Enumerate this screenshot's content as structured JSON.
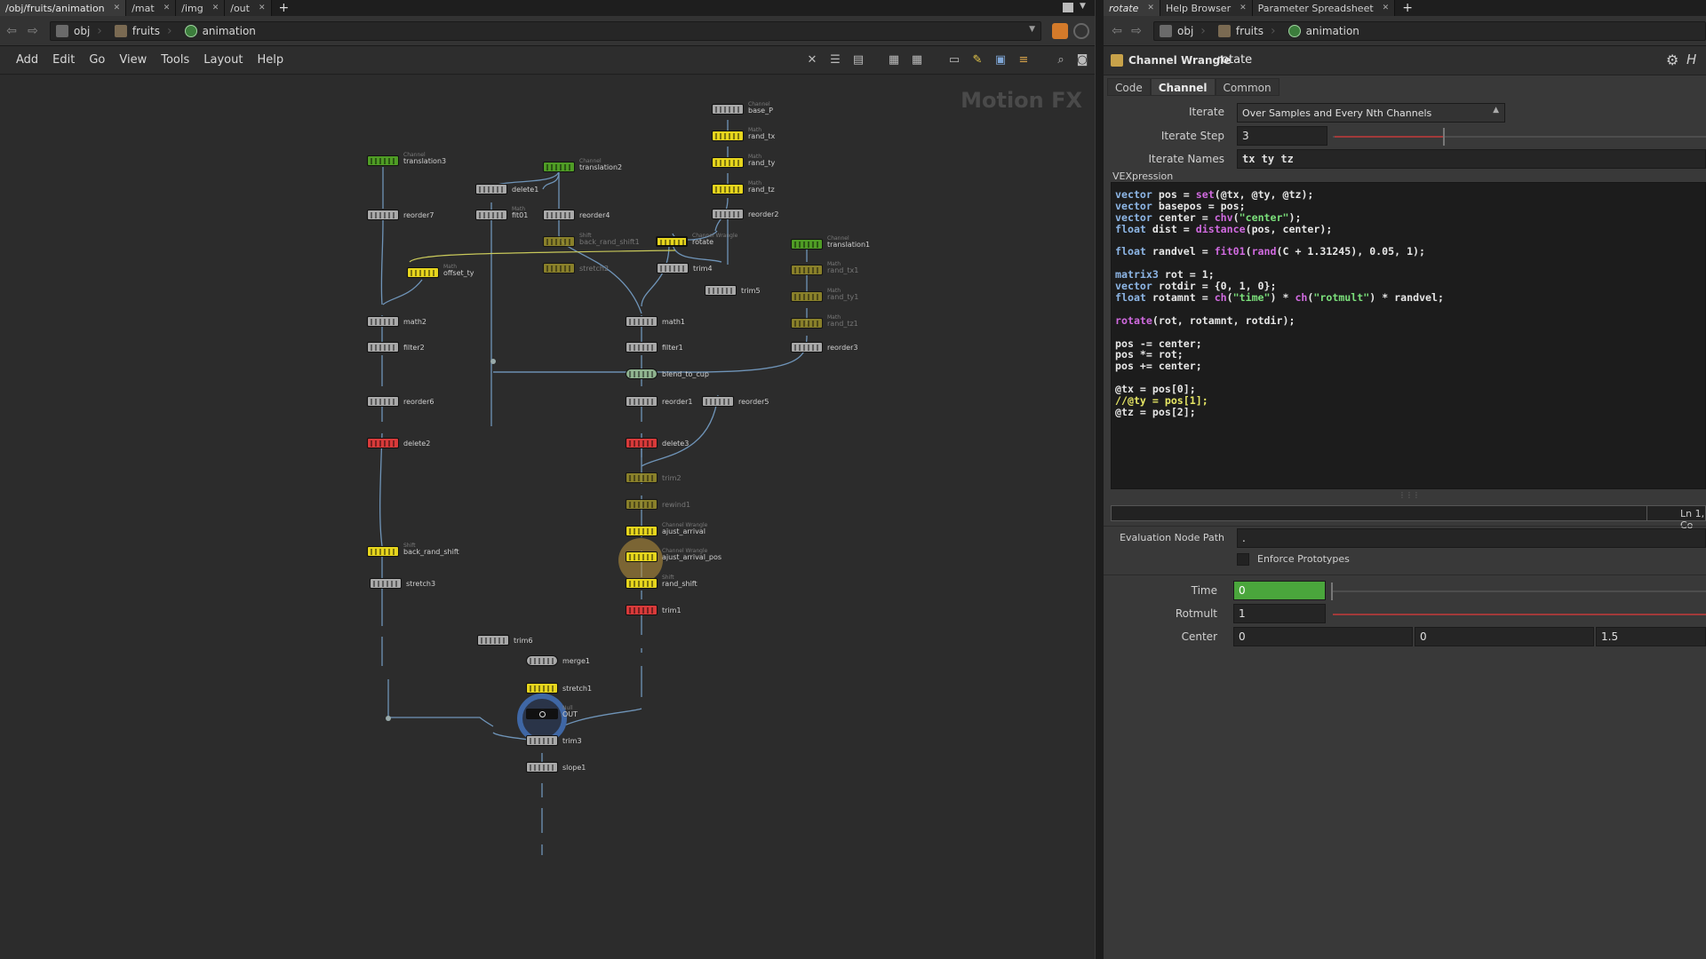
{
  "left_tabs": [
    {
      "label": "/obj/fruits/animation"
    },
    {
      "label": "/mat"
    },
    {
      "label": "/img"
    },
    {
      "label": "/out"
    }
  ],
  "right_tabs": [
    {
      "label": "rotate"
    },
    {
      "label": "Help Browser"
    },
    {
      "label": "Parameter Spreadsheet"
    }
  ],
  "path_left": {
    "obj": "obj",
    "fruits": "fruits",
    "animation": "animation"
  },
  "path_right": {
    "obj": "obj",
    "fruits": "fruits",
    "animation": "animation"
  },
  "menu": [
    "Add",
    "Edit",
    "Go",
    "View",
    "Tools",
    "Layout",
    "Help"
  ],
  "network": {
    "watermark": "Motion FX",
    "nodes": [
      {
        "id": "base_P",
        "label": "base_P",
        "type": "Channel"
      },
      {
        "id": "rand_tx",
        "label": "rand_tx",
        "type": "Math"
      },
      {
        "id": "rand_ty",
        "label": "rand_ty",
        "type": "Math"
      },
      {
        "id": "rand_tz",
        "label": "rand_tz",
        "type": "Math"
      },
      {
        "id": "reorder2",
        "label": "reorder2",
        "type": ""
      },
      {
        "id": "translation3",
        "label": "translation3",
        "type": "Channel"
      },
      {
        "id": "translation2",
        "label": "translation2",
        "type": "Channel"
      },
      {
        "id": "delete1",
        "label": "delete1",
        "type": ""
      },
      {
        "id": "fit01",
        "label": "fit01",
        "type": "Math"
      },
      {
        "id": "reorder7",
        "label": "reorder7",
        "type": ""
      },
      {
        "id": "reorder4",
        "label": "reorder4",
        "type": ""
      },
      {
        "id": "back_rand_shift1",
        "label": "back_rand_shift1",
        "type": "Shift"
      },
      {
        "id": "rotate",
        "label": "rotate",
        "type": "Channel Wrangle"
      },
      {
        "id": "translation1",
        "label": "translation1",
        "type": "Channel"
      },
      {
        "id": "offset_ty",
        "label": "offset_ty",
        "type": "Math"
      },
      {
        "id": "stretch2",
        "label": "stretch2",
        "type": ""
      },
      {
        "id": "trim4",
        "label": "trim4",
        "type": ""
      },
      {
        "id": "rand_tx1",
        "label": "rand_tx1",
        "type": "Math"
      },
      {
        "id": "trim5",
        "label": "trim5",
        "type": ""
      },
      {
        "id": "rand_ty1",
        "label": "rand_ty1",
        "type": "Math"
      },
      {
        "id": "math2",
        "label": "math2",
        "type": ""
      },
      {
        "id": "math1",
        "label": "math1",
        "type": ""
      },
      {
        "id": "rand_tz1",
        "label": "rand_tz1",
        "type": "Math"
      },
      {
        "id": "filter2",
        "label": "filter2",
        "type": ""
      },
      {
        "id": "filter1",
        "label": "filter1",
        "type": ""
      },
      {
        "id": "reorder3",
        "label": "reorder3",
        "type": ""
      },
      {
        "id": "blend_to_cup",
        "label": "blend_to_cup",
        "type": ""
      },
      {
        "id": "reorder6",
        "label": "reorder6",
        "type": ""
      },
      {
        "id": "reorder1",
        "label": "reorder1",
        "type": ""
      },
      {
        "id": "reorder5",
        "label": "reorder5",
        "type": ""
      },
      {
        "id": "delete2",
        "label": "delete2",
        "type": ""
      },
      {
        "id": "delete3",
        "label": "delete3",
        "type": ""
      },
      {
        "id": "trim2",
        "label": "trim2",
        "type": ""
      },
      {
        "id": "rewind1",
        "label": "rewind1",
        "type": ""
      },
      {
        "id": "ajust_arrival",
        "label": "ajust_arrival",
        "type": "Channel Wrangle"
      },
      {
        "id": "ajust_arrival_pos",
        "label": "ajust_arrival_pos",
        "type": "Channel Wrangle"
      },
      {
        "id": "back_rand_shift",
        "label": "back_rand_shift",
        "type": "Shift"
      },
      {
        "id": "stretch3",
        "label": "stretch3",
        "type": ""
      },
      {
        "id": "rand_shift",
        "label": "rand_shift",
        "type": "Shift"
      },
      {
        "id": "trim1",
        "label": "trim1",
        "type": ""
      },
      {
        "id": "trim6",
        "label": "trim6",
        "type": ""
      },
      {
        "id": "merge1",
        "label": "merge1",
        "type": ""
      },
      {
        "id": "stretch1",
        "label": "stretch1",
        "type": ""
      },
      {
        "id": "OUT",
        "label": "OUT",
        "type": "Null"
      },
      {
        "id": "trim3",
        "label": "trim3",
        "type": ""
      },
      {
        "id": "slope1",
        "label": "slope1",
        "type": ""
      }
    ]
  },
  "params": {
    "node_type": "Channel Wrangle",
    "node_name": "rotate",
    "tabs": [
      "Code",
      "Channel",
      "Common"
    ],
    "iterate_label": "Iterate",
    "iterate_value": "Over Samples and Every Nth Channels",
    "iterate_step_label": "Iterate Step",
    "iterate_step_value": "3",
    "iterate_names_label": "Iterate Names",
    "iterate_names_value": "tx ty tz",
    "vexpression_label": "VEXpression",
    "code_lines": [
      "vector pos = set(@tx, @ty, @tz);",
      "vector basepos = pos;",
      "vector center = chv(\"center\");",
      "float dist = distance(pos, center);",
      "",
      "float randvel = fit01(rand(C + 1.31245), 0.05, 1);",
      "",
      "matrix3 rot = 1;",
      "vector rotdir = {0, 1, 0};",
      "float rotamnt = ch(\"time\") * ch(\"rotmult\") * randvel;",
      "",
      "rotate(rot, rotamnt, rotdir);",
      "",
      "pos -= center;",
      "pos *= rot;",
      "pos += center;",
      "",
      "@tx = pos[0];",
      "//@ty = pos[1];",
      "@tz = pos[2];"
    ],
    "status_line": "Ln 1, Co",
    "eval_path_label": "Evaluation Node Path",
    "eval_path_value": ".",
    "enforce_label": "Enforce Prototypes",
    "time_label": "Time",
    "time_value": "0",
    "rotmult_label": "Rotmult",
    "rotmult_value": "1",
    "center_label": "Center",
    "center_values": [
      "0",
      "0",
      "1.5"
    ]
  },
  "colors": {
    "node_yellow": "#e6d51d",
    "node_green": "#4f9c25",
    "node_red": "#d83a3a",
    "node_gray": "#a9a9a9",
    "time_field": "#4aa63c"
  }
}
